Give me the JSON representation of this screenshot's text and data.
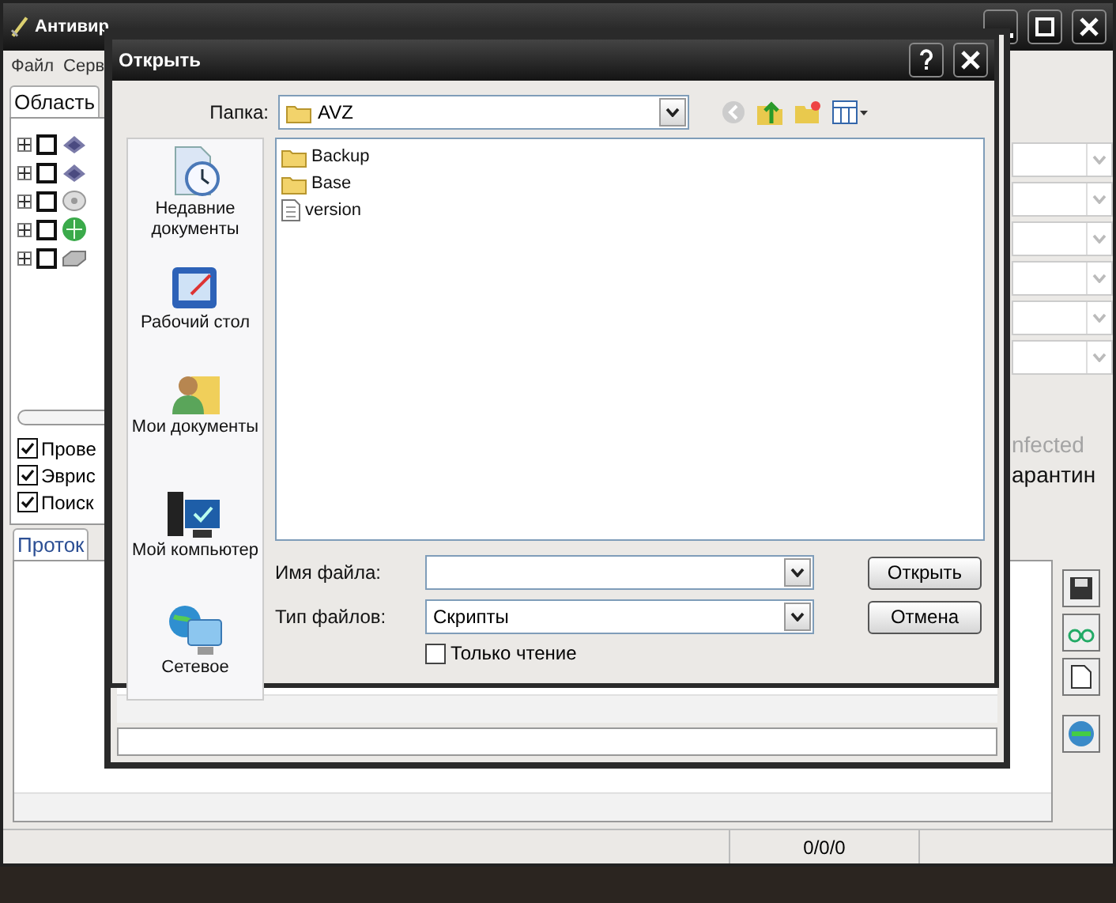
{
  "main_window": {
    "title": "Антивир",
    "menu": [
      "Файл",
      "Серв"
    ],
    "scan_tab": "Область",
    "tree": [
      {
        "kind": "disk",
        "checked": false
      },
      {
        "kind": "disk",
        "checked": false
      },
      {
        "kind": "cdrom",
        "checked": false
      },
      {
        "kind": "network",
        "checked": false
      },
      {
        "kind": "drive",
        "checked": false
      }
    ],
    "progress": {
      "level": 0
    },
    "options": [
      {
        "label": "Прове",
        "checked": true
      },
      {
        "label": "Эврис",
        "checked": true
      },
      {
        "label": "Поиск",
        "checked": true
      }
    ],
    "infected": {
      "label": "nfected",
      "disabled": true
    },
    "quarantine": "арантин",
    "log_tab": "Проток",
    "status": "0/0/0"
  },
  "dialog": {
    "title": "Открыть",
    "folder_label": "Папка:",
    "folder": "AVZ",
    "places": [
      {
        "kind": "recent",
        "label": "Недавние документы"
      },
      {
        "kind": "desktop",
        "label": "Рабочий стол"
      },
      {
        "kind": "documents",
        "label": "Мои документы"
      },
      {
        "kind": "computer",
        "label": "Мой компьютер"
      },
      {
        "kind": "network",
        "label": "Сетевое"
      }
    ],
    "files": [
      {
        "kind": "folder",
        "name": "Backup"
      },
      {
        "kind": "folder",
        "name": "Base"
      },
      {
        "kind": "file",
        "name": "version"
      }
    ],
    "filename_label": "Имя файла:",
    "filetype_label": "Тип файлов:",
    "filetype": "Скрипты",
    "readonly": {
      "label": "Только чтение",
      "checked": false
    },
    "buttons": [
      "Открыть",
      "Отмена"
    ]
  }
}
